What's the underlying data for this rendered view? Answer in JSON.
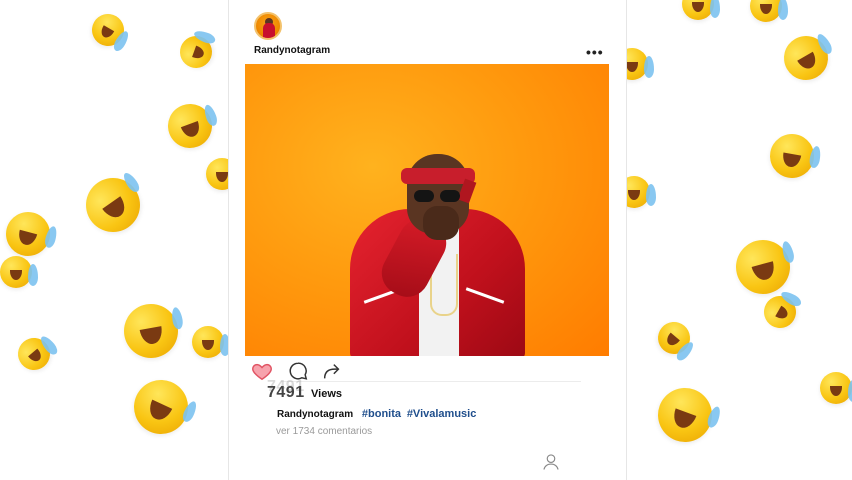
{
  "post": {
    "username": "Randynotagram",
    "more_label": "•••",
    "views_count": "7491",
    "views_label": "Views",
    "caption_user": "Randynotagram",
    "hashtags": [
      "#bonita",
      "#Vivalamusic"
    ],
    "comments_link": "ver 1734 comentarios"
  },
  "icons": {
    "like": "heart-icon",
    "comment": "comment-bubble-icon",
    "share": "share-arrow-icon",
    "more": "more-dots-icon",
    "profile": "profile-icon"
  },
  "colors": {
    "photo_background": "#ff8c00",
    "heart": "#f26d7d",
    "hashtag": "#1f4e8c",
    "jacket": "#d81c28"
  }
}
